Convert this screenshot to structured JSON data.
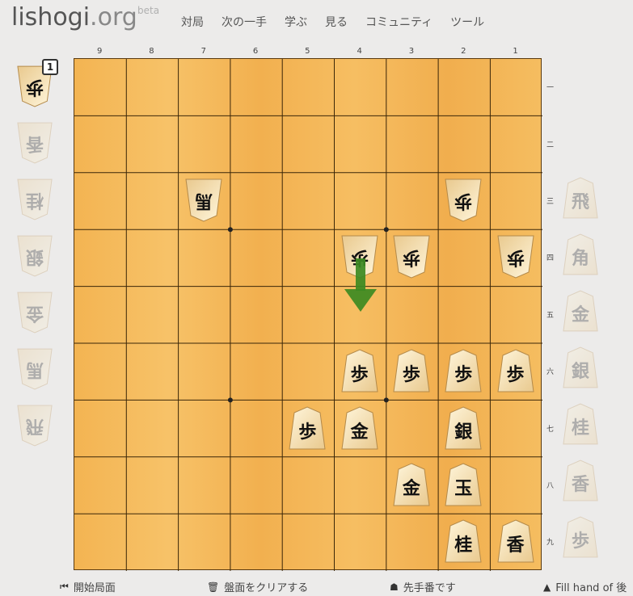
{
  "header": {
    "logo_main": "lishogi",
    "logo_tld": ".org",
    "beta": "beta",
    "nav": [
      "対局",
      "次の一手",
      "学ぶ",
      "見る",
      "コミュニティ",
      "ツール"
    ]
  },
  "board": {
    "files": [
      "9",
      "8",
      "7",
      "6",
      "5",
      "4",
      "3",
      "2",
      "1"
    ],
    "ranks": [
      "一",
      "二",
      "三",
      "四",
      "五",
      "六",
      "七",
      "八",
      "九"
    ],
    "pieces": [
      {
        "name": "gote-horse-7-3",
        "kanji": "馬",
        "side": "gote"
      },
      {
        "name": "gote-pawn-2-3",
        "kanji": "歩",
        "side": "gote"
      },
      {
        "name": "gote-pawn-4-4",
        "kanji": "歩",
        "side": "gote"
      },
      {
        "name": "gote-pawn-3-4",
        "kanji": "歩",
        "side": "gote"
      },
      {
        "name": "gote-pawn-1-4",
        "kanji": "歩",
        "side": "gote"
      },
      {
        "name": "sente-pawn-4-6",
        "kanji": "歩",
        "side": "sente"
      },
      {
        "name": "sente-pawn-3-6",
        "kanji": "歩",
        "side": "sente"
      },
      {
        "name": "sente-pawn-2-6",
        "kanji": "歩",
        "side": "sente"
      },
      {
        "name": "sente-pawn-1-6",
        "kanji": "歩",
        "side": "sente"
      },
      {
        "name": "sente-pawn-5-7",
        "kanji": "歩",
        "side": "sente"
      },
      {
        "name": "sente-gold-4-7",
        "kanji": "金",
        "side": "sente"
      },
      {
        "name": "sente-silver-2-7",
        "kanji": "銀",
        "side": "sente"
      },
      {
        "name": "sente-gold-3-8",
        "kanji": "金",
        "side": "sente"
      },
      {
        "name": "sente-king-2-8",
        "kanji": "玉",
        "side": "sente"
      },
      {
        "name": "sente-knight-2-9",
        "kanji": "桂",
        "side": "sente"
      },
      {
        "name": "sente-lance-1-9",
        "kanji": "香",
        "side": "sente"
      }
    ]
  },
  "gote_spares": {
    "count": "1",
    "pieces": [
      "歩",
      "香",
      "桂",
      "銀",
      "金",
      "馬",
      "飛"
    ]
  },
  "sente_spares": {
    "pieces": [
      "飛",
      "角",
      "金",
      "銀",
      "桂",
      "香",
      "歩"
    ]
  },
  "footer": {
    "start_position": "開始局面",
    "clear_board": "盤面をクリアする",
    "turn": "先手番です",
    "fill_hand": "Fill hand of 後"
  },
  "colors": {
    "board": "#f5b85a",
    "arrow": "#3c8a22",
    "background": "#ecebea"
  }
}
